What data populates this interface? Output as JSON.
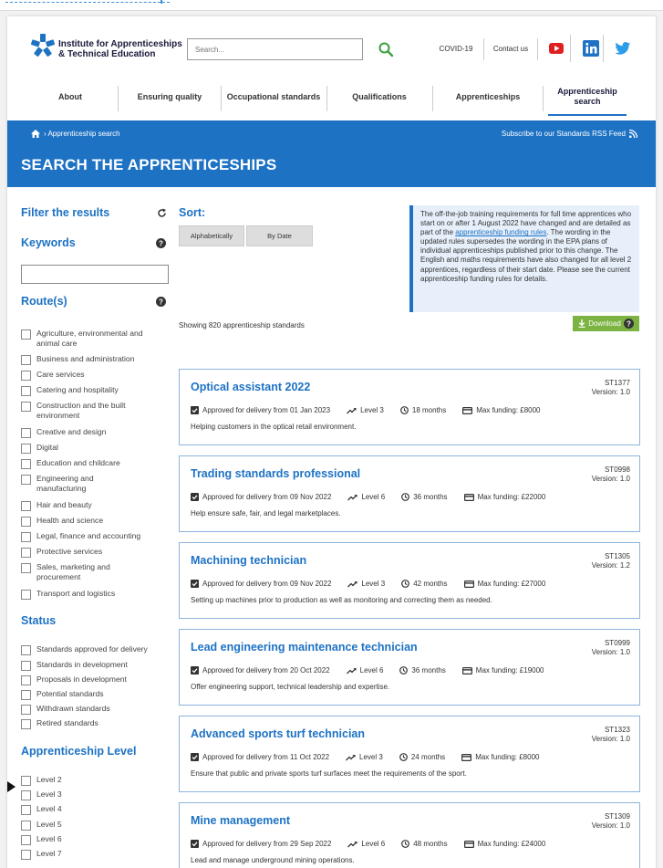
{
  "header": {
    "logo_line1": "Institute for Apprenticeships",
    "logo_line2": "& Technical Education",
    "search_placeholder": "Search...",
    "covid_link": "COVID-19",
    "contact_link": "Contact us"
  },
  "nav": [
    {
      "label": "About"
    },
    {
      "label": "Ensuring quality"
    },
    {
      "label": "Occupational standards"
    },
    {
      "label": "Qualifications"
    },
    {
      "label": "Apprenticeships"
    },
    {
      "label": "Apprenticeship search"
    }
  ],
  "banner": {
    "breadcrumb": "› Apprenticeship search",
    "rss": "Subscribe to our Standards RSS Feed",
    "title": "SEARCH THE APPRENTICESHIPS"
  },
  "sidebar": {
    "filter_heading": "Filter the results",
    "keywords_heading": "Keywords",
    "routes_heading": "Route(s)",
    "routes": [
      "Agriculture, environmental and animal care",
      "Business and administration",
      "Care services",
      "Catering and hospitality",
      "Construction and the built environment",
      "Creative and design",
      "Digital",
      "Education and childcare",
      "Engineering and manufacturing",
      "Hair and beauty",
      "Health and science",
      "Legal, finance and accounting",
      "Protective services",
      "Sales, marketing and procurement",
      "Transport and logistics"
    ],
    "status_heading": "Status",
    "statuses": [
      "Standards approved for delivery",
      "Standards in development",
      "Proposals in development",
      "Potential standards",
      "Withdrawn standards",
      "Retired standards"
    ],
    "level_heading": "Apprenticeship Level",
    "levels": [
      "Level 2",
      "Level 3",
      "Level 4",
      "Level 5",
      "Level 6",
      "Level 7"
    ]
  },
  "sort": {
    "heading": "Sort:",
    "alpha": "Alphabetically",
    "date": "By Date"
  },
  "notice": {
    "part1": "The off-the-job training requirements for full time apprentices who start on or after 1 August 2022 have changed and are detailed as part of the ",
    "link": "apprenticeship funding rules",
    "part2": ". The wording in the updated rules supersedes the wording in the EPA plans of individual apprenticeships published prior to this change. The English and maths requirements have also changed for all level 2 apprentices, regardless of their start date. Please see the current apprenticeship funding rules for details."
  },
  "results": {
    "showing": "Showing 820 apprenticeship standards",
    "download": "Download"
  },
  "cards": [
    {
      "title": "Optical assistant 2022",
      "code": "ST1377",
      "version": "Version: 1.0",
      "approved": "Approved for delivery from 01 Jan 2023",
      "level": "Level 3",
      "duration": "18 months",
      "funding": "Max funding: £8000",
      "desc": "Helping customers in the optical retail environment."
    },
    {
      "title": "Trading standards professional",
      "code": "ST0998",
      "version": "Version: 1.0",
      "approved": "Approved for delivery from 09 Nov 2022",
      "level": "Level 6",
      "duration": "36 months",
      "funding": "Max funding: £22000",
      "desc": "Help ensure safe, fair, and legal marketplaces."
    },
    {
      "title": "Machining technician",
      "code": "ST1305",
      "version": "Version: 1.2",
      "approved": "Approved for delivery from 09 Nov 2022",
      "level": "Level 3",
      "duration": "42 months",
      "funding": "Max funding: £27000",
      "desc": "Setting up machines prior to production as well as monitoring and correcting them as needed."
    },
    {
      "title": "Lead engineering maintenance technician",
      "code": "ST0999",
      "version": "Version: 1.0",
      "approved": "Approved for delivery from 20 Oct 2022",
      "level": "Level 6",
      "duration": "36 months",
      "funding": "Max funding: £19000",
      "desc": "Offer engineering support, technical leadership and expertise."
    },
    {
      "title": "Advanced sports turf technician",
      "code": "ST1323",
      "version": "Version: 1.0",
      "approved": "Approved for delivery from 11 Oct 2022",
      "level": "Level 3",
      "duration": "24 months",
      "funding": "Max funding: £8000",
      "desc": "Ensure that public and private sports turf surfaces meet the requirements of the sport."
    },
    {
      "title": "Mine management",
      "code": "ST1309",
      "version": "Version: 1.0",
      "approved": "Approved for delivery from 29 Sep 2022",
      "level": "Level 6",
      "duration": "48 months",
      "funding": "Max funding: £24000",
      "desc": "Lead and manage underground mining operations."
    }
  ],
  "colors": {
    "brand_blue": "#1d72c4",
    "download_green": "#7cb342",
    "youtube_red": "#e02020",
    "linkedin_blue": "#1d72c4",
    "twitter_blue": "#2a9ce8"
  }
}
